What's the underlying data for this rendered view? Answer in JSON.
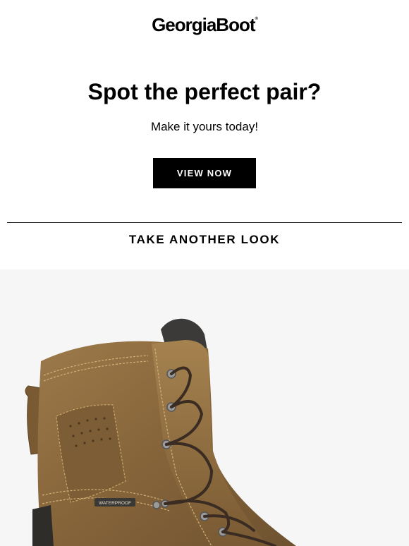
{
  "header": {
    "logo_text": "GeorgiaBoot",
    "logo_mark": "®"
  },
  "hero": {
    "headline": "Spot the perfect pair?",
    "subhead": "Make it yours today!",
    "cta_label": "VIEW NOW"
  },
  "section": {
    "title": "TAKE ANOTHER LOOK"
  },
  "product": {
    "image_icon": "work-boot-image",
    "badge_text": "WATERPROOF"
  },
  "colors": {
    "button_bg": "#000000",
    "button_text": "#ffffff",
    "image_bg": "#f6f6f6",
    "leather": "#8a6a3e"
  }
}
